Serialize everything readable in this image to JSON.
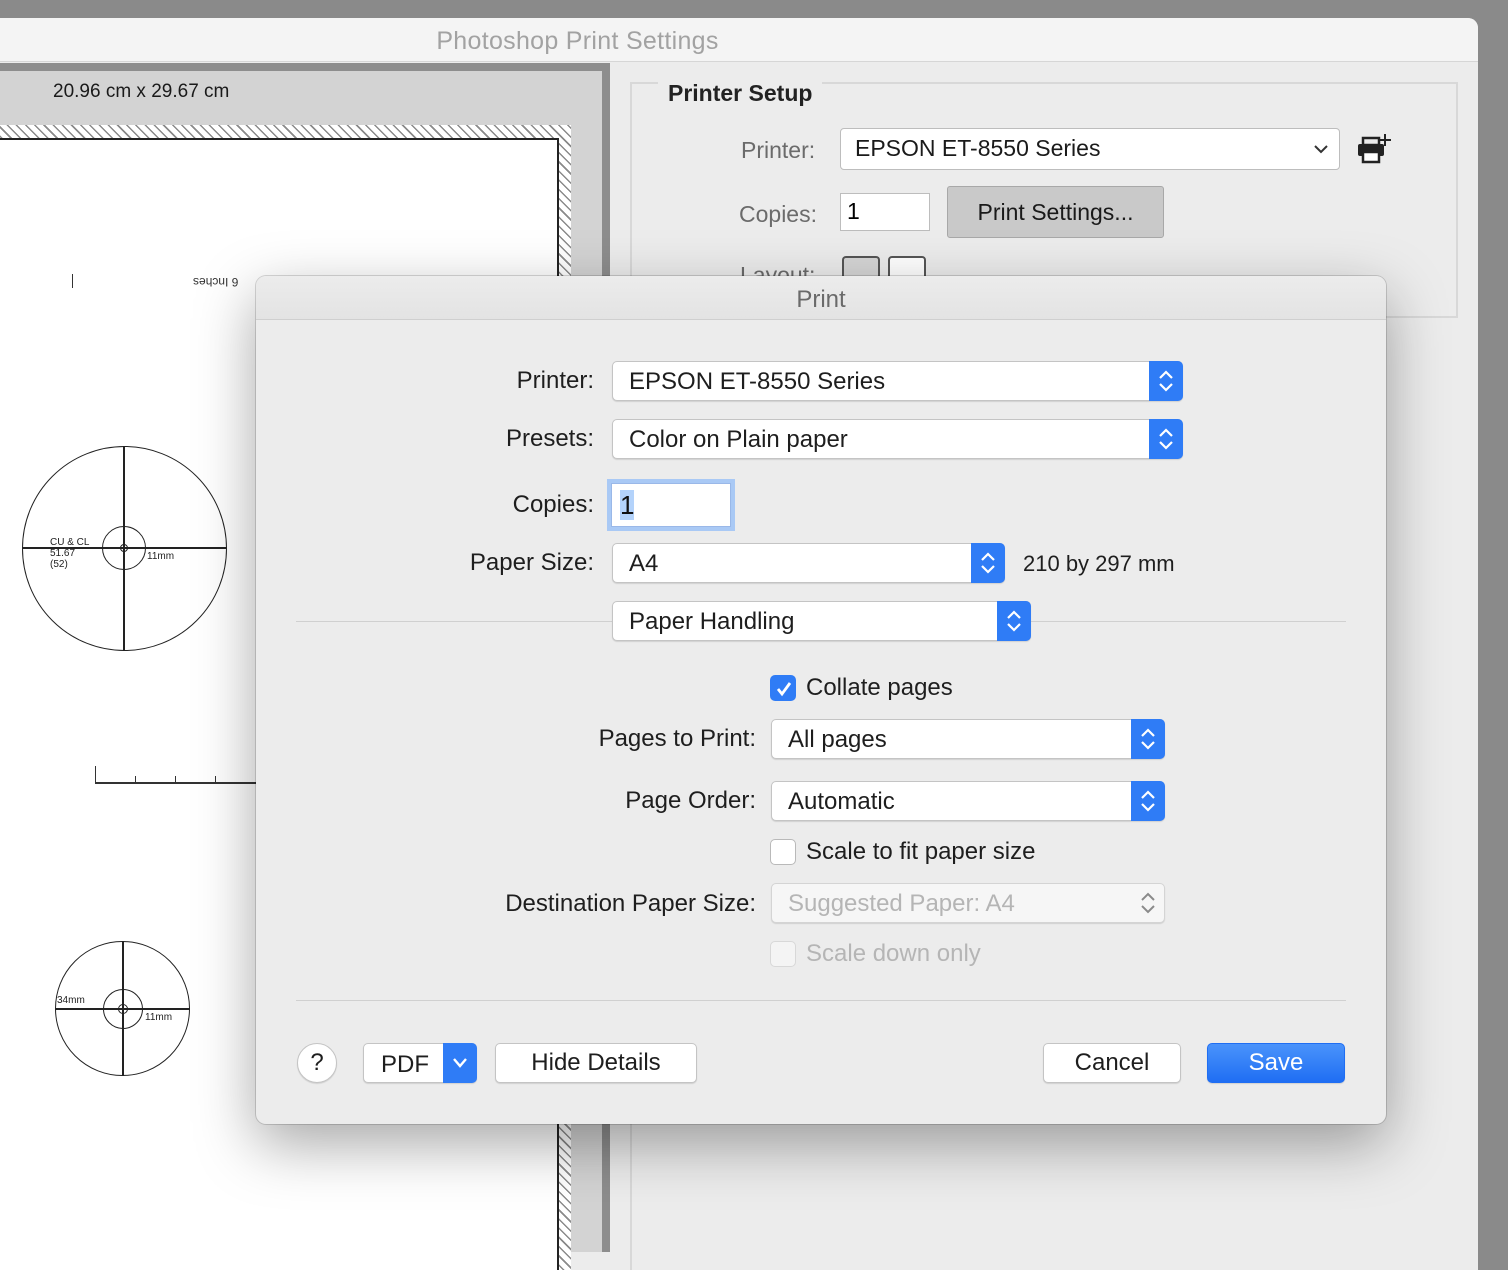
{
  "window": {
    "title": "Photoshop Print Settings"
  },
  "preview": {
    "dimensions": "20.96 cm x 29.67 cm",
    "ruler_label": "6 Inches",
    "target1": {
      "label_line1": "CU & CL",
      "label_line2": "51.67",
      "label_line3": "(52)",
      "size_label": "11mm"
    },
    "target2": {
      "left_label": "34mm",
      "size_label": "11mm"
    }
  },
  "printer_setup": {
    "header": "Printer Setup",
    "printer_label": "Printer:",
    "printer_value": "EPSON ET-8550 Series",
    "copies_label": "Copies:",
    "copies_value": "1",
    "print_settings_button": "Print Settings...",
    "layout_label": "Layout:"
  },
  "print_dialog": {
    "title": "Print",
    "printer_label": "Printer:",
    "printer_value": "EPSON ET-8550 Series",
    "presets_label": "Presets:",
    "presets_value": "Color on Plain paper",
    "copies_label": "Copies:",
    "copies_value": "1",
    "paper_size_label": "Paper Size:",
    "paper_size_value": "A4",
    "paper_size_note": "210 by 297 mm",
    "section_value": "Paper Handling",
    "collate_label": "Collate pages",
    "collate_checked": true,
    "pages_to_print_label": "Pages to Print:",
    "pages_to_print_value": "All pages",
    "page_order_label": "Page Order:",
    "page_order_value": "Automatic",
    "scale_to_fit_label": "Scale to fit paper size",
    "scale_to_fit_checked": false,
    "destination_label": "Destination Paper Size:",
    "destination_value": "Suggested Paper: A4",
    "scale_down_label": "Scale down only",
    "help_label": "?",
    "pdf_label": "PDF",
    "hide_details_label": "Hide Details",
    "cancel_label": "Cancel",
    "save_label": "Save"
  },
  "colors": {
    "accent": "#2f7cf6",
    "dialog_bg": "#ececec",
    "disabled_text": "#b5b5b5"
  }
}
